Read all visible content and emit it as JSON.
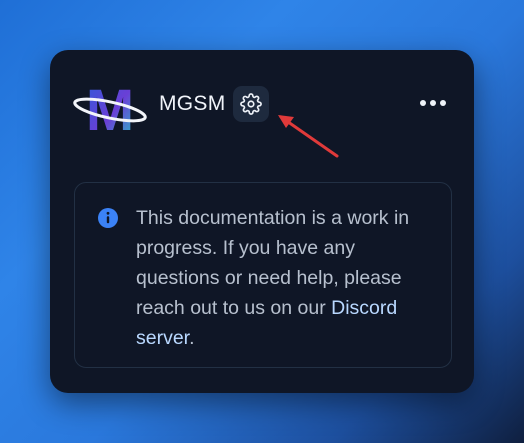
{
  "header": {
    "app_name": "MGSM",
    "logo_letter": "M",
    "settings_icon": "gear-icon",
    "menu_icon": "more-horizontal-icon"
  },
  "notice": {
    "icon": "info-icon",
    "text_before": "This documentation is a work in progress. If you have any questions or need help, please reach out to us on our ",
    "link_label": "Discord server",
    "text_after": "."
  },
  "colors": {
    "card_bg": "#0f1626",
    "gear_bg": "#1e2a3e",
    "info_blue": "#3b82f6",
    "link": "#b9d8ff",
    "arrow": "#e03a3a"
  }
}
